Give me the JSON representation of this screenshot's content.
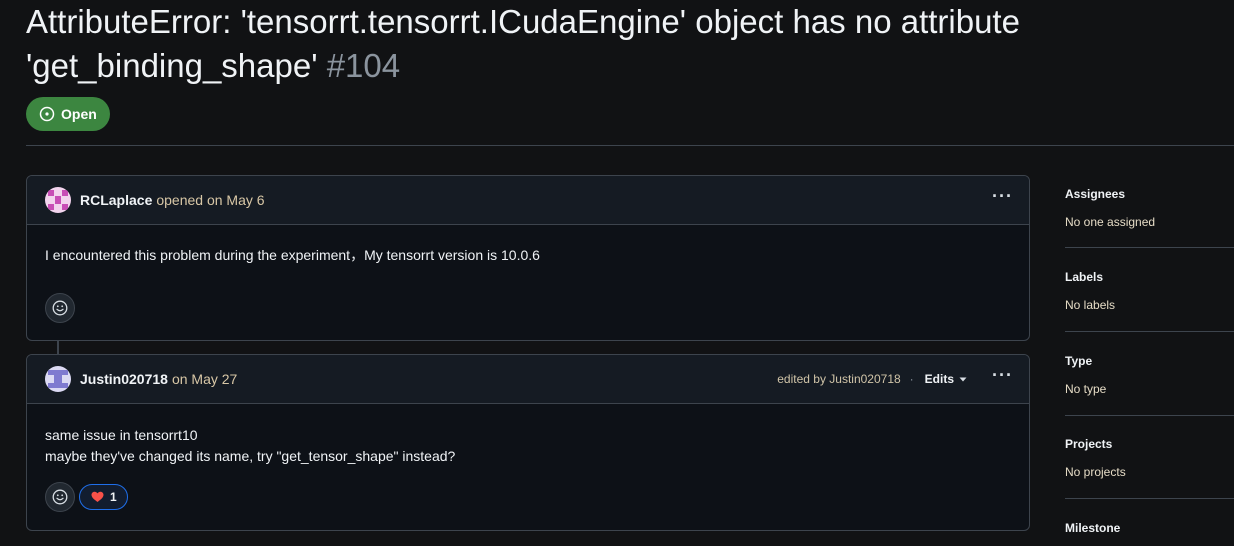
{
  "issue": {
    "title": "AttributeError: 'tensorrt.tensorrt.ICudaEngine' object has no attribute 'get_binding_shape'",
    "number": "#104",
    "state": "Open"
  },
  "comments": [
    {
      "author": "RCLaplace",
      "action": "opened on May 6",
      "body": [
        "I encountered this problem during the experiment，My tensorrt version is 10.0.6"
      ],
      "reactions": []
    },
    {
      "author": "Justin020718",
      "action": "on May 27",
      "edited_text": "edited by Justin020718",
      "edits_label": "Edits",
      "body": [
        "same issue in tensorrt10",
        "maybe they've changed its name, try \"get_tensor_shape\" instead?"
      ],
      "reactions": [
        {
          "icon": "heart-icon",
          "count": "1"
        }
      ]
    }
  ],
  "sidebar": {
    "assignees": {
      "heading": "Assignees",
      "value": "No one assigned"
    },
    "labels": {
      "heading": "Labels",
      "value": "No labels"
    },
    "type": {
      "heading": "Type",
      "value": "No type"
    },
    "projects": {
      "heading": "Projects",
      "value": "No projects"
    },
    "milestone": {
      "heading": "Milestone"
    }
  },
  "icons": {
    "state": "issue-opened-icon",
    "menu": "kebab-menu-icon",
    "add_reaction": "smiley-icon",
    "dropdown": "triangle-down-icon"
  },
  "colors": {
    "open_badge": "#3c8640",
    "heart": "#f85149",
    "reaction_border": "#1f6feb"
  }
}
